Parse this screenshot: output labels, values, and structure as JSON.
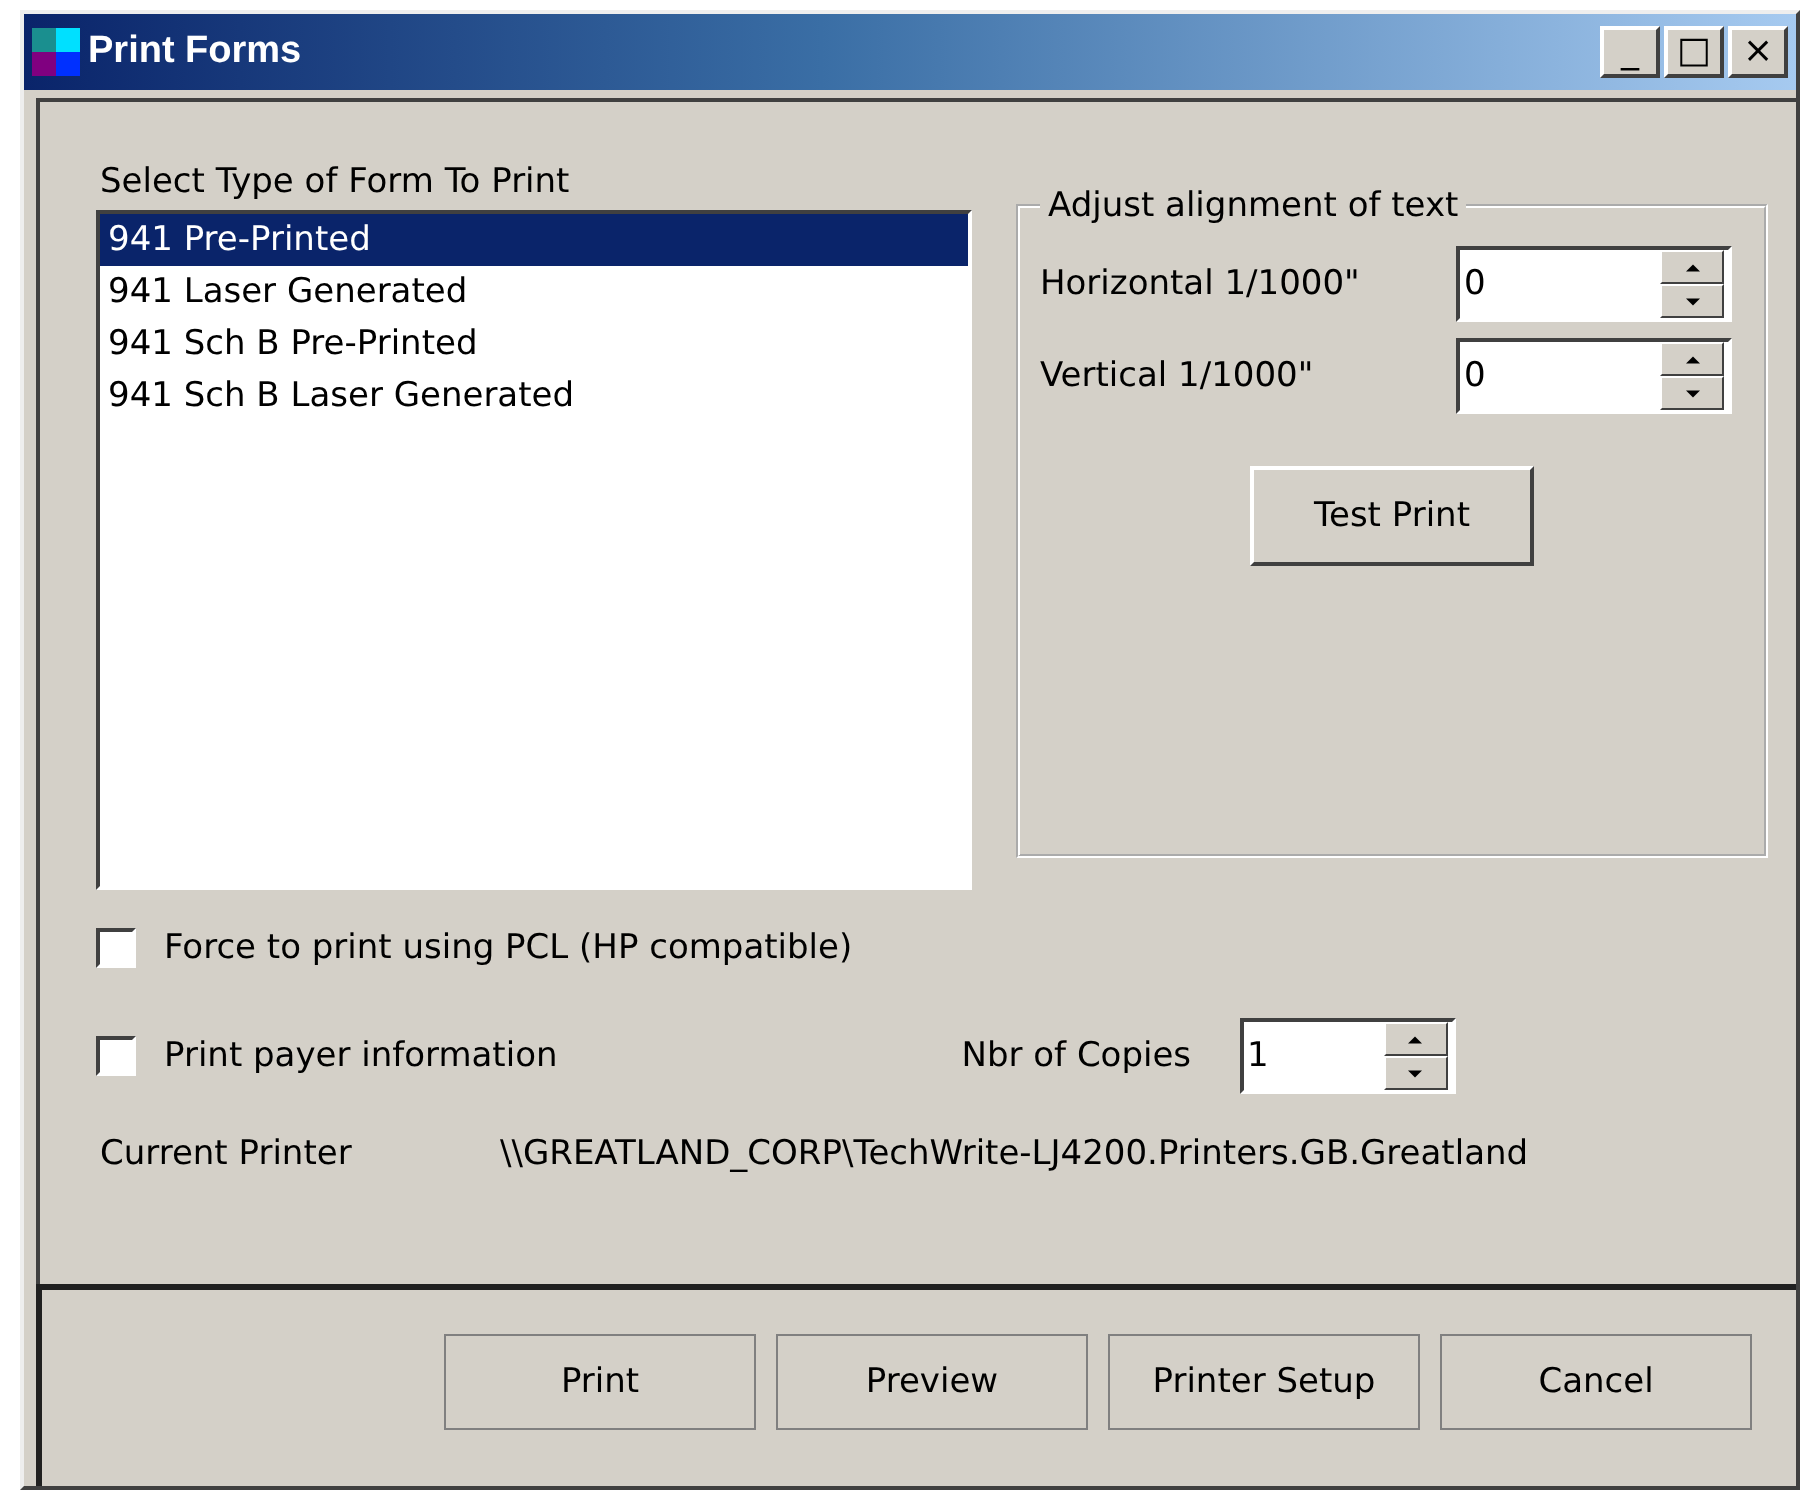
{
  "window": {
    "title": "Print Forms",
    "controls": [
      "_",
      "□",
      "×"
    ]
  },
  "form_list": {
    "label": "Select Type of Form To Print",
    "items": [
      {
        "label": "941 Pre-Printed",
        "selected": true
      },
      {
        "label": "941 Laser Generated",
        "selected": false
      },
      {
        "label": "941 Sch B Pre-Printed",
        "selected": false
      },
      {
        "label": "941 Sch B Laser Generated",
        "selected": false
      }
    ]
  },
  "alignment": {
    "title": "Adjust alignment of text",
    "fields": [
      {
        "label": "Horizontal 1/1000\"",
        "value": "0"
      },
      {
        "label": "Vertical 1/1000\"",
        "value": "0"
      }
    ],
    "button": "Test Print"
  },
  "options": [
    {
      "label": "Force to print using PCL (HP compatible)",
      "checked": false
    },
    {
      "label": "Print payer information",
      "checked": false
    }
  ],
  "copies": {
    "label": "Nbr of Copies",
    "value": "1"
  },
  "printer": {
    "label": "Current Printer",
    "value": "\\\\GREATLAND_CORP\\TechWrite-LJ4200.Printers.GB.Greatland"
  },
  "buttons": [
    "Print",
    "Preview",
    "Printer Setup",
    "Cancel"
  ]
}
